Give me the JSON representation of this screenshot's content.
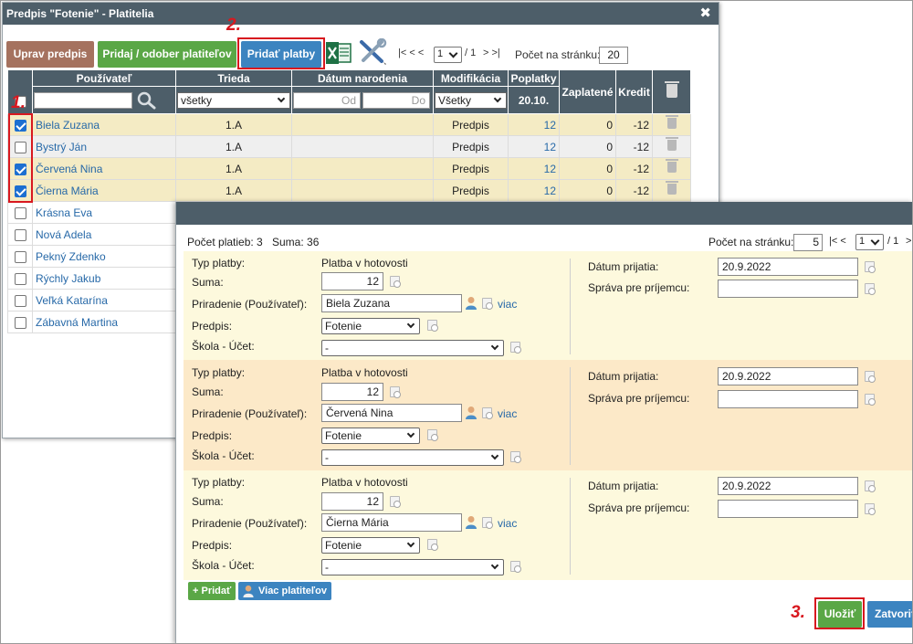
{
  "window1": {
    "title": "Predpis \"Fotenie\" - Platitelia",
    "close_glyph": "✖",
    "buttons": {
      "edit": "Uprav predpis",
      "add_remove": "Pridaj / odober platiteľov",
      "add_payments": "Pridať platby"
    },
    "pager": {
      "first_prev": "|< < <",
      "page": "1",
      "of": "/ 1",
      "next_last": "> >|",
      "per_page_label": "Počet na stránku:",
      "per_page": "20"
    },
    "columns": {
      "user": "Používateľ",
      "class": "Trieda",
      "birthdate": "Dátum narodenia",
      "modification": "Modifikácia",
      "fees": "Poplatky",
      "fees_date": "20.10.",
      "paid": "Zaplatené",
      "credit": "Kredit"
    },
    "filters": {
      "class_select": "všetky",
      "date_from": "Od",
      "date_to": "Do",
      "modification_select": "Všetky"
    },
    "rows": [
      {
        "name": "Biela Zuzana",
        "class": "1.A",
        "mod": "Predpis",
        "fee": "12",
        "paid": "0",
        "credit": "-12",
        "checked": true
      },
      {
        "name": "Bystrý Ján",
        "class": "1.A",
        "mod": "Predpis",
        "fee": "12",
        "paid": "0",
        "credit": "-12",
        "checked": false
      },
      {
        "name": "Červená Nina",
        "class": "1.A",
        "mod": "Predpis",
        "fee": "12",
        "paid": "0",
        "credit": "-12",
        "checked": true
      },
      {
        "name": "Čierna Mária",
        "class": "1.A",
        "mod": "Predpis",
        "fee": "12",
        "paid": "0",
        "credit": "-12",
        "checked": true
      },
      {
        "name": "Krásna Eva",
        "checked": false
      },
      {
        "name": "Nová Adela",
        "checked": false
      },
      {
        "name": "Pekný Zdenko",
        "checked": false
      },
      {
        "name": "Rýchly Jakub",
        "checked": false
      },
      {
        "name": "Veľká Katarína",
        "checked": false
      },
      {
        "name": "Zábavná Martina",
        "checked": false
      }
    ]
  },
  "steps": {
    "s1": "1.",
    "s2": "2.",
    "s3": "3."
  },
  "window2": {
    "count_label": "Počet platieb: 3",
    "sum_label": "Suma: 36",
    "per_page_label": "Počet na stránku:",
    "per_page": "5",
    "pager_first_prev": "|< <",
    "page": "1",
    "of": "/ 1",
    "pager_next": ">",
    "labels": {
      "type": "Typ platby:",
      "amount": "Suma:",
      "assign": "Priradenie (Používateľ):",
      "prescription": "Predpis:",
      "school_account": "Škola - Účet:",
      "date_received": "Dátum prijatia:",
      "message": "Správa pre príjemcu:"
    },
    "payments": [
      {
        "type": "Platba v hotovosti",
        "amount": "12",
        "user": "Biela Zuzana",
        "prescription": "Fotenie",
        "account": "-",
        "date": "20.9.2022",
        "message": "",
        "more": "viac"
      },
      {
        "type": "Platba v hotovosti",
        "amount": "12",
        "user": "Červená Nina",
        "prescription": "Fotenie",
        "account": "-",
        "date": "20.9.2022",
        "message": "",
        "more": "viac"
      },
      {
        "type": "Platba v hotovosti",
        "amount": "12",
        "user": "Čierna Mária",
        "prescription": "Fotenie",
        "account": "-",
        "date": "20.9.2022",
        "message": "",
        "more": "viac"
      }
    ],
    "buttons": {
      "add": "+ Pridať",
      "more_payers": "Viac platiteľov",
      "save": "Uložiť",
      "close": "Zatvoriť"
    }
  },
  "colors": {
    "header": "#4d5e69",
    "highlight": "#d8181f",
    "green": "#5aa746",
    "blue": "#3c84c0",
    "brown": "#a5725f",
    "selected_row": "#f4ebc4",
    "payment_yellow": "#fdf9dd",
    "payment_orange": "#fce9c8"
  },
  "icons": [
    "close-icon",
    "excel-icon",
    "tools-icon",
    "search-icon",
    "trash-icon",
    "copy-icon",
    "user-icon",
    "chevron-down-icon"
  ]
}
